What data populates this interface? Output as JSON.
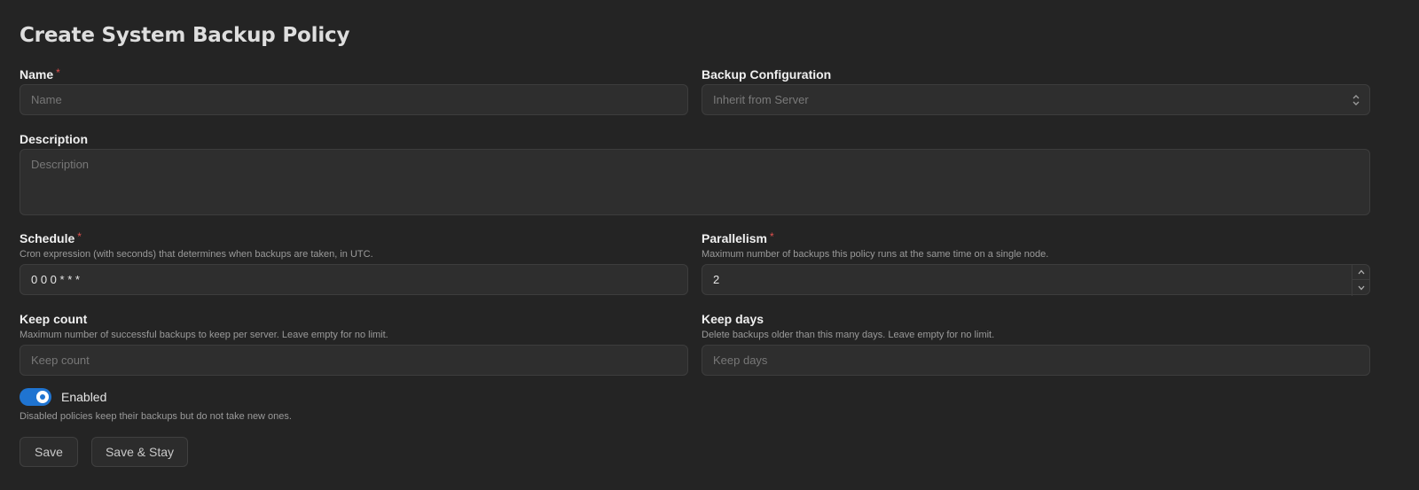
{
  "page": {
    "title": "Create System Backup Policy"
  },
  "fields": {
    "name": {
      "label": "Name",
      "required": "*",
      "placeholder": "Name",
      "value": ""
    },
    "backup_configuration": {
      "label": "Backup Configuration",
      "selected": "Inherit from Server",
      "icon": "select-arrows-icon"
    },
    "description": {
      "label": "Description",
      "placeholder": "Description",
      "value": ""
    },
    "schedule": {
      "label": "Schedule",
      "required": "*",
      "help": "Cron expression (with seconds) that determines when backups are taken, in UTC.",
      "value": "0 0 0 * * *"
    },
    "parallelism": {
      "label": "Parallelism",
      "required": "*",
      "help": "Maximum number of backups this policy runs at the same time on a single node.",
      "value": "2"
    },
    "keep_count": {
      "label": "Keep count",
      "help": "Maximum number of successful backups to keep per server. Leave empty for no limit.",
      "placeholder": "Keep count",
      "value": ""
    },
    "keep_days": {
      "label": "Keep days",
      "help": "Delete backups older than this many days. Leave empty for no limit.",
      "placeholder": "Keep days",
      "value": ""
    },
    "enabled": {
      "label": "Enabled",
      "checked": true,
      "help": "Disabled policies keep their backups but do not take new ones."
    }
  },
  "actions": {
    "save": "Save",
    "save_stay": "Save & Stay"
  },
  "colors": {
    "background": "#242424",
    "accent": "#1f74d1",
    "required": "#e0504d"
  }
}
